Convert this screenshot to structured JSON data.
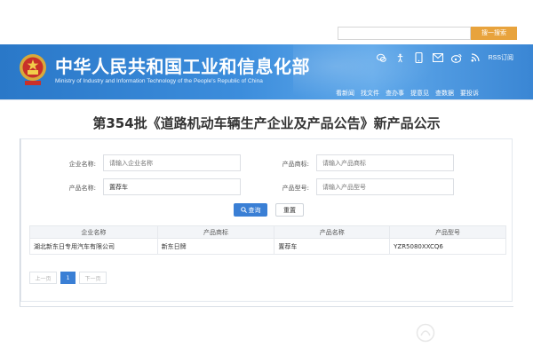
{
  "header": {
    "ministry_cn": "中华人民共和国工业和信息化部",
    "ministry_en": "Ministry of Industry and Information Technology of the People's Republic of China",
    "rss_label": "RSS订阅",
    "search_button": "搜一搜索",
    "links": [
      "看新闻",
      "找文件",
      "查办事",
      "提意见",
      "查数据",
      "要投诉"
    ],
    "icons": [
      "wechat-icon",
      "accessibility-icon",
      "mobile-icon",
      "mail-icon",
      "weibo-icon",
      "rss-icon"
    ],
    "colors": {
      "banner": "#3c8ddc",
      "search_button": "#e8a33d"
    }
  },
  "page": {
    "title": "第354批《道路机动车辆生产企业及产品公告》新产品公示"
  },
  "form": {
    "company_label": "企业名称:",
    "company_placeholder": "请输入企业名称",
    "brand_label": "产品商标:",
    "brand_placeholder": "请输入产品商标",
    "product_label": "产品名称:",
    "product_value": "置荐车",
    "model_label": "产品型号:",
    "model_placeholder": "请输入产品型号",
    "query_button": "查询",
    "reset_button": "重置",
    "accent_color": "#3a7fd5"
  },
  "table": {
    "columns": [
      "企业名称",
      "产品商标",
      "产品名称",
      "产品型号"
    ],
    "rows": [
      [
        "湖北新东日专用汽车有限公司",
        "新东日牌",
        "置荐车",
        "YZR5080XXCQ6"
      ]
    ]
  },
  "pagination": {
    "prev": "上一页",
    "current": "1",
    "next": "下一页"
  }
}
